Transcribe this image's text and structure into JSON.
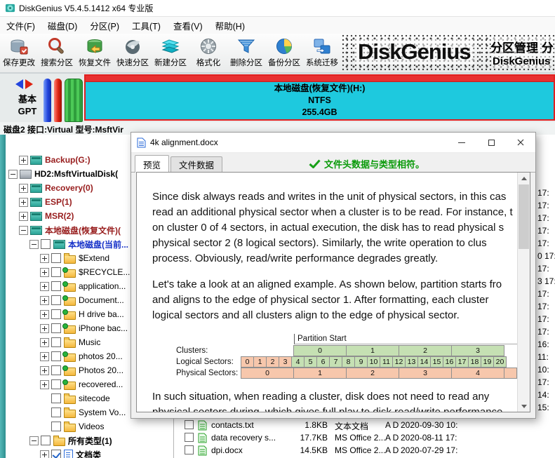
{
  "window": {
    "title": "DiskGenius V5.4.5.1412 x64 专业版"
  },
  "menu": {
    "items": [
      "文件(F)",
      "磁盘(D)",
      "分区(P)",
      "工具(T)",
      "查看(V)",
      "帮助(H)"
    ]
  },
  "toolbar": {
    "buttons": [
      {
        "label": "保存更改",
        "icon": "save-icon"
      },
      {
        "label": "搜索分区",
        "icon": "search-icon"
      },
      {
        "label": "恢复文件",
        "icon": "recover-files-icon"
      },
      {
        "label": "快速分区",
        "icon": "quick-partition-icon"
      },
      {
        "label": "新建分区",
        "icon": "new-partition-icon"
      },
      {
        "label": "格式化",
        "icon": "format-icon"
      },
      {
        "label": "删除分区",
        "icon": "delete-partition-icon"
      },
      {
        "label": "备份分区",
        "icon": "backup-partition-icon"
      },
      {
        "label": "系统迁移",
        "icon": "system-migration-icon"
      }
    ],
    "logo": {
      "brand": "DiskGenius",
      "tagline_top": "分区管理 分",
      "tagline_bottom": "DiskGenius"
    }
  },
  "partition_view": {
    "mode_line1": "基本",
    "mode_line2": "GPT",
    "selected_partition": {
      "name": "本地磁盘(恢复文件)(H:)",
      "fs": "NTFS",
      "size": "255.4GB"
    },
    "disk_info": "磁盘2 接口:Virtual 型号:MsftVir"
  },
  "tree": {
    "items": [
      {
        "id": "backup-g",
        "label": "Backup(G:)",
        "level": 1,
        "expand": "plus",
        "checkbox": null,
        "icon": "partition",
        "color": "maroon",
        "bold": true,
        "dot": false
      },
      {
        "id": "hd2-msftvirtualdisk",
        "label": "HD2:MsftVirtualDisk(",
        "level": 0,
        "expand": "minus",
        "checkbox": null,
        "icon": "disk",
        "color": "black",
        "bold": true,
        "dot": false
      },
      {
        "id": "recovery-0",
        "label": "Recovery(0)",
        "level": 1,
        "expand": "plus",
        "checkbox": null,
        "icon": "partition",
        "color": "maroon",
        "bold": true,
        "dot": false
      },
      {
        "id": "esp-1",
        "label": "ESP(1)",
        "level": 1,
        "expand": "plus",
        "checkbox": null,
        "icon": "partition",
        "color": "maroon",
        "bold": true,
        "dot": false
      },
      {
        "id": "msr-2",
        "label": "MSR(2)",
        "level": 1,
        "expand": "plus",
        "checkbox": null,
        "icon": "partition",
        "color": "maroon",
        "bold": true,
        "dot": false
      },
      {
        "id": "local-disk-recovery-h",
        "label": "本地磁盘(恢复文件)(",
        "level": 1,
        "expand": "minus",
        "checkbox": null,
        "icon": "partition",
        "color": "maroon",
        "bold": true,
        "dot": false
      },
      {
        "id": "local-disk-current",
        "label": "本地磁盘(当前...",
        "level": 2,
        "expand": "minus",
        "checkbox": "unchecked",
        "icon": "partition",
        "color": "blue",
        "bold": true,
        "dot": false
      },
      {
        "id": "extend",
        "label": "$Extend",
        "level": 3,
        "expand": "plus",
        "checkbox": "unchecked",
        "icon": "folder",
        "color": "black",
        "bold": false,
        "dot": false
      },
      {
        "id": "recycle-bin",
        "label": "$RECYCLE...",
        "level": 3,
        "expand": "plus",
        "checkbox": "unchecked",
        "icon": "folder",
        "color": "black",
        "bold": false,
        "dot": true
      },
      {
        "id": "application",
        "label": "application...",
        "level": 3,
        "expand": "plus",
        "checkbox": "unchecked",
        "icon": "folder",
        "color": "black",
        "bold": false,
        "dot": true
      },
      {
        "id": "documents",
        "label": "Document...",
        "level": 3,
        "expand": "plus",
        "checkbox": "unchecked",
        "icon": "folder",
        "color": "black",
        "bold": false,
        "dot": true
      },
      {
        "id": "h-drive-backup",
        "label": "H drive ba...",
        "level": 3,
        "expand": "plus",
        "checkbox": "unchecked",
        "icon": "folder",
        "color": "black",
        "bold": false,
        "dot": true
      },
      {
        "id": "iphone-backup",
        "label": "iPhone bac...",
        "level": 3,
        "expand": "plus",
        "checkbox": "unchecked",
        "icon": "folder",
        "color": "black",
        "bold": false,
        "dot": true
      },
      {
        "id": "music",
        "label": "Music",
        "level": 3,
        "expand": "plus",
        "checkbox": "unchecked",
        "icon": "folder",
        "color": "black",
        "bold": false,
        "dot": false
      },
      {
        "id": "photos-lower",
        "label": "photos 20...",
        "level": 3,
        "expand": "plus",
        "checkbox": "unchecked",
        "icon": "folder",
        "color": "black",
        "bold": false,
        "dot": true
      },
      {
        "id": "photos-upper",
        "label": "Photos 20...",
        "level": 3,
        "expand": "plus",
        "checkbox": "unchecked",
        "icon": "folder",
        "color": "black",
        "bold": false,
        "dot": true
      },
      {
        "id": "recovered",
        "label": "recovered...",
        "level": 3,
        "expand": "plus",
        "checkbox": "unchecked",
        "icon": "folder",
        "color": "black",
        "bold": false,
        "dot": true
      },
      {
        "id": "sitecode",
        "label": "sitecode",
        "level": 3,
        "expand": null,
        "checkbox": "unchecked",
        "icon": "folder",
        "color": "black",
        "bold": false,
        "dot": false
      },
      {
        "id": "system-volume",
        "label": "System Vo...",
        "level": 3,
        "expand": null,
        "checkbox": "unchecked",
        "icon": "folder",
        "color": "black",
        "bold": false,
        "dot": false
      },
      {
        "id": "videos",
        "label": "Videos",
        "level": 3,
        "expand": null,
        "checkbox": "unchecked",
        "icon": "folder",
        "color": "black",
        "bold": false,
        "dot": false
      },
      {
        "id": "all-types",
        "label": "所有类型(1)",
        "level": 2,
        "expand": "minus",
        "checkbox": "unchecked",
        "icon": "folder",
        "color": "black",
        "bold": true,
        "dot": false
      },
      {
        "id": "document-class",
        "label": "文档类",
        "level": 3,
        "expand": "plus",
        "checkbox": "checked",
        "icon": "doc",
        "color": "black",
        "bold": true,
        "dot": false
      }
    ]
  },
  "file_list": {
    "rows": [
      {
        "name": "contacts.txt",
        "size": "1.8KB",
        "type": "文本文档",
        "attr": "A D",
        "time": "2020-09-30 10:"
      },
      {
        "name": "data recovery s...",
        "size": "17.7KB",
        "type": "MS Office 2...",
        "attr": "A D",
        "time": "2020-08-11 17:"
      },
      {
        "name": "dpi.docx",
        "size": "14.5KB",
        "type": "MS Office 2...",
        "attr": "A D",
        "time": "2020-07-29 17:"
      }
    ],
    "edge_times": [
      "17:",
      "17:",
      "17:",
      "17:",
      "17:",
      "0 17:",
      "17:",
      "3 17:",
      "17:",
      "17:",
      "17:",
      "17:",
      "16:",
      "11:",
      "10:",
      "17:",
      "14:",
      "15:"
    ]
  },
  "dialog": {
    "title": "4k alignment.docx",
    "tabs": [
      "预览",
      "文件数据"
    ],
    "active_tab": "预览",
    "status": "文件头数据与类型相符。",
    "doc": {
      "paragraphs_before_table": [
        [
          "Since disk always reads and writes in the unit of physical sectors, in this cas",
          "read an additional physical sector when a cluster is to be read. For instance, t",
          "on cluster 0 of 4 sectors, in actual execution, the disk has to read physical s",
          "physical sector 2 (8 logical sectors). Similarly, the write operation to clus",
          "process. Obviously, read/write performance degrades greatly."
        ],
        [
          "Let's take a look at an aligned example. As shown below, partition starts fro",
          "and aligns to the edge of physical sector 1. After formatting, each cluster",
          "logical sectors and all clusters align to the edge of physical sector."
        ]
      ],
      "paragraphs_after_table": [
        [
          "In such situation, when reading a cluster, disk does not need to read any",
          "physical sectors during, which gives full play to disk read/write performance"
        ]
      ],
      "table": {
        "partition_start_label": "Partition Start",
        "row_labels": [
          "Clusters:",
          "Logical Sectors:",
          "Physical Sectors:"
        ],
        "clusters": [
          "0",
          "1",
          "2",
          "3"
        ],
        "logical_sectors": [
          "0",
          "1",
          "2",
          "3",
          "4",
          "5",
          "6",
          "7",
          "8",
          "9",
          "10",
          "11",
          "12",
          "13",
          "14",
          "15",
          "16",
          "17",
          "18",
          "19",
          "20"
        ],
        "physical_sectors": [
          "0",
          "1",
          "2",
          "3",
          "4"
        ]
      }
    }
  },
  "colors": {
    "partition_fill": "#1EC9DE",
    "partition_border": "#E02020",
    "status_green": "#0A9A0A",
    "table_green": "#C5E0B3",
    "table_orange": "#F7C7AC"
  }
}
